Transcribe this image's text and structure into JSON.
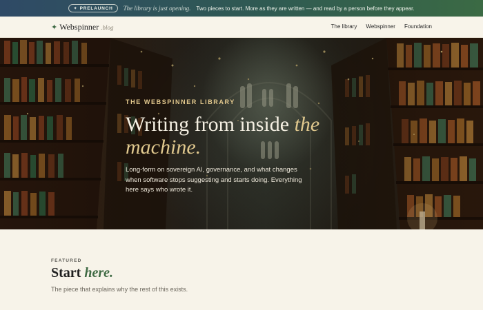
{
  "announcement": {
    "badge": "PRELAUNCH",
    "tagline": "The library is just opening.",
    "message": "Two pieces to start. More as they are written — and read by a person before they appear."
  },
  "nav": {
    "brand_name": "Webspinner",
    "brand_suffix": ".blog",
    "links": [
      "The library",
      "Webspinner",
      "Foundation"
    ]
  },
  "hero": {
    "eyebrow": "THE WEBSPINNER LIBRARY",
    "title_plain": "Writing from inside ",
    "title_em_1": "the",
    "title_em_2": "machine.",
    "description": "Long-form on sovereign AI, governance, and what changes when software stops suggesting and starts doing. Everything here says who wrote it."
  },
  "featured": {
    "label": "FEATURED",
    "heading_plain": "Start ",
    "heading_em": "here.",
    "subtitle": "The piece that explains why the rest of this exists."
  },
  "colors": {
    "accent_green": "#3f6a44",
    "accent_gold": "#e0c88e",
    "background": "#f7f3e9"
  }
}
